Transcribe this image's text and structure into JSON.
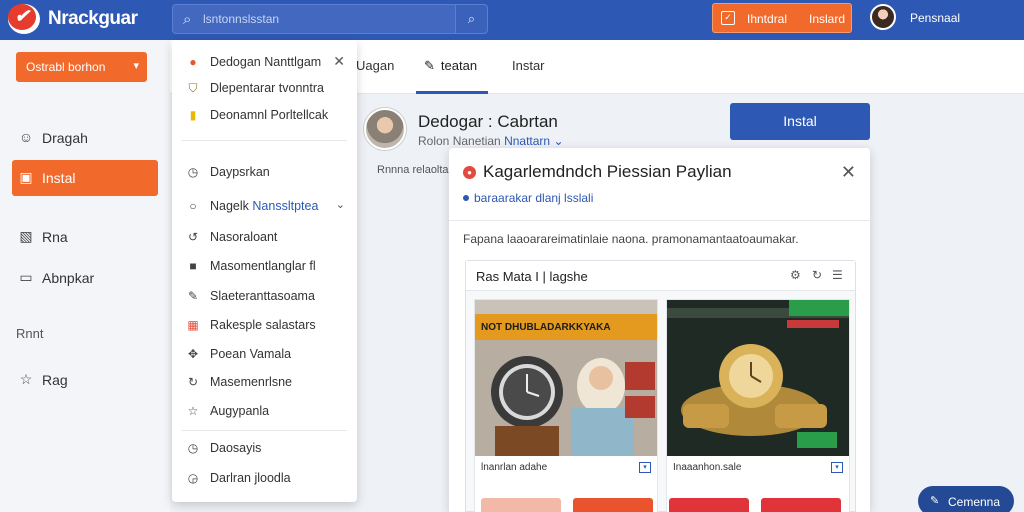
{
  "app": {
    "title": "Nrackguar"
  },
  "search": {
    "placeholder": "lsntonnslsstan",
    "button_icon": "search-icon"
  },
  "top_action": {
    "label_1": "Ihntdral",
    "label_2": "Inslard"
  },
  "user": {
    "name": "Pensnaal"
  },
  "sidebar": {
    "primary_button": "Ostrabl borhon",
    "items": [
      {
        "label": "Dragah",
        "icon": "smile-icon"
      },
      {
        "label": "Instal",
        "icon": "install-icon",
        "active": true
      },
      {
        "label": "Rna",
        "icon": "image-icon"
      },
      {
        "label": "Abnpkar",
        "icon": "chat-icon"
      }
    ],
    "section_heading": "Rnnt",
    "extra_item": {
      "label": "Rag",
      "icon": "star-icon"
    }
  },
  "dropdown": {
    "items": [
      {
        "label": "Dedogan Nanttlgam",
        "icon": "check-circle-icon",
        "icon_color": "#e2582e"
      },
      {
        "label": "Dlepentarar tvonntra",
        "icon": "shield-icon",
        "icon_color": "#8a7a1a"
      },
      {
        "label": "Deonamnl Porltellcak",
        "icon": "folder-icon",
        "icon_color": "#e6b800"
      },
      {
        "label": "Daypsrkan",
        "icon": "clock-icon"
      },
      {
        "label": "Nagelk",
        "sub_label": "Nanssltptea",
        "icon": "circle-icon"
      },
      {
        "label": "Nasoraloant",
        "icon": "loop-icon"
      },
      {
        "label": "Masomentlanglar fl",
        "icon": "lock-icon"
      },
      {
        "label": "Slaeteranttasoama",
        "icon": "edit-icon"
      },
      {
        "label": "Rakesple salastars",
        "icon": "grid-icon",
        "icon_color": "#e14a3c"
      },
      {
        "label": "Poean Vamala",
        "icon": "move-icon"
      },
      {
        "label": "Masemenrlsne",
        "icon": "loop-icon"
      },
      {
        "label": "Augypanla",
        "icon": "star-icon"
      },
      {
        "label": "Daosayis",
        "icon": "clock-icon"
      },
      {
        "label": "Darlran jloodla",
        "icon": "clock-icon"
      }
    ]
  },
  "tabs": [
    {
      "label": "Uagan"
    },
    {
      "label": "teatan",
      "icon": "pen-icon",
      "active": true
    },
    {
      "label": "Instar"
    }
  ],
  "profile": {
    "name": "Dedogar : Cabrtan",
    "sub": "Rolon Nanetian",
    "sub_link": "Nnattarn",
    "caption": "Rnnna relaoltapt"
  },
  "install_button": "Instal",
  "modal": {
    "title": "Kagarlemdndch Piessian Paylian",
    "subtitle": "baraarakar dlanj lsslali",
    "description": "Fapana laaoarareimatinlaie naona. pramonamantaatoaumakar.",
    "panel": {
      "title": "Ras Mata I | lagshe",
      "tools": [
        "settings-icon",
        "refresh-icon",
        "list-icon"
      ]
    },
    "cards": [
      {
        "caption": "lnanrlan adahe",
        "banner_text": "NOT DHUBLADARKKYAKA",
        "theme": "#e39a1e"
      },
      {
        "caption": "Inaaanhon.sale",
        "banner_text": "",
        "theme": "#2a9d4a"
      }
    ]
  },
  "fab": {
    "label": "Cemenna"
  },
  "colors": {
    "brand_blue": "#2d58b3",
    "accent_orange": "#f26a2b"
  }
}
